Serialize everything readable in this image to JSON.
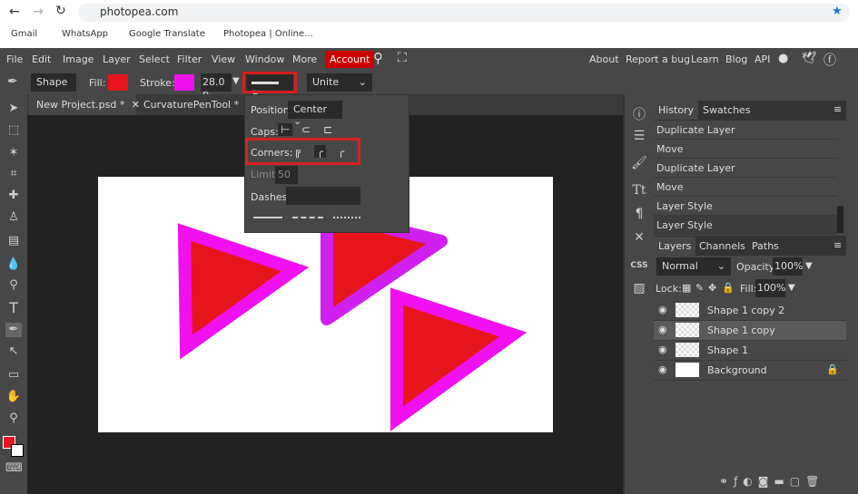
{
  "browser": {
    "url": "photopea.com",
    "bookmarks": [
      "Gmail",
      "WhatsApp",
      "Google Translate",
      "Photopea | Online..."
    ]
  },
  "menu": {
    "items": [
      "File",
      "Edit",
      "Image",
      "Layer",
      "Select",
      "Filter",
      "View",
      "Window",
      "More"
    ],
    "account": "Account",
    "right": [
      "About",
      "Report a bug",
      "Learn",
      "Blog",
      "API"
    ]
  },
  "options": {
    "mode": "Shape",
    "fill_label": "Fill:",
    "fill_color": "#e8141c",
    "stroke_label": "Stroke:",
    "stroke_color": "#f010f0",
    "stroke_width": "28.0 p",
    "combine": "Unite"
  },
  "tabs": [
    "New Project.psd *",
    "CurvaturePenTool  *"
  ],
  "stroke_popup": {
    "position_label": "Position:",
    "position": "Center",
    "caps_label": "Caps:",
    "corners_label": "Corners:",
    "limit_label": "Limit:",
    "limit": "50",
    "dashes_label": "Dashes:",
    "dashes": ""
  },
  "history": {
    "tabs": [
      "History",
      "Swatches"
    ],
    "items": [
      "Duplicate Layer",
      "Move",
      "Duplicate Layer",
      "Move",
      "Layer Style",
      "Layer Style"
    ]
  },
  "layers": {
    "tabs": [
      "Layers",
      "Channels",
      "Paths"
    ],
    "blend": "Normal",
    "opacity_label": "Opacity:",
    "opacity": "100%",
    "lock_label": "Lock:",
    "fill_label": "Fill:",
    "fill": "100%",
    "items": [
      "Shape 1 copy 2",
      "Shape 1 copy",
      "Shape 1",
      "Background"
    ],
    "selected": "Shape 1 copy"
  },
  "colors": {
    "accent": "#c00000",
    "highlight": "#d62020"
  }
}
